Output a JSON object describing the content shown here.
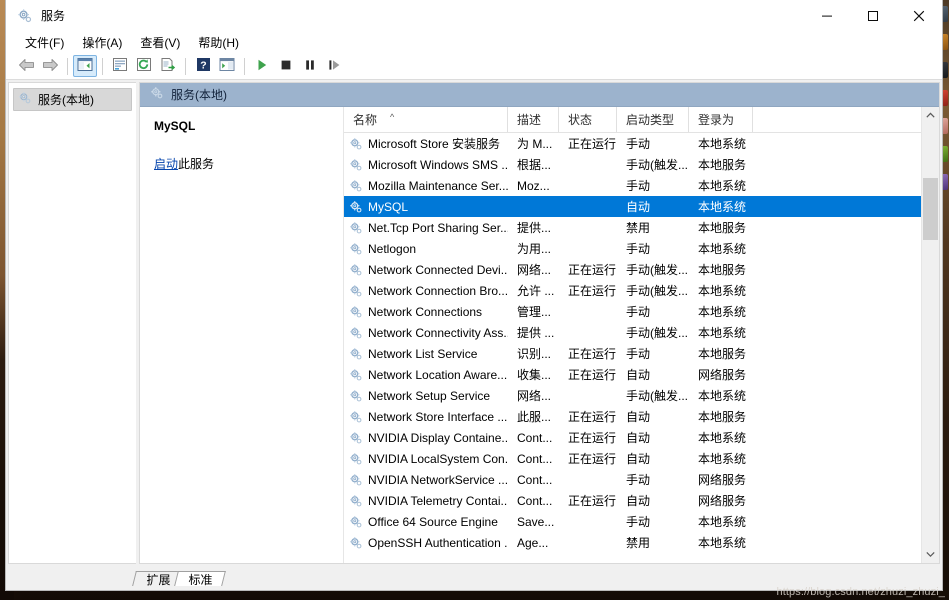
{
  "window": {
    "title": "服务",
    "app_icon": "services-gear-icon",
    "controls": {
      "minimize": "—",
      "maximize": "▭",
      "close": "✕"
    }
  },
  "menubar": {
    "items": [
      {
        "label": "文件(F)",
        "name": "menu-file"
      },
      {
        "label": "操作(A)",
        "name": "menu-action"
      },
      {
        "label": "查看(V)",
        "name": "menu-view"
      },
      {
        "label": "帮助(H)",
        "name": "menu-help"
      }
    ]
  },
  "toolbar": {
    "buttons": [
      {
        "icon": "back-arrow-icon",
        "name": "toolbar-back",
        "pressed": false
      },
      {
        "icon": "forward-arrow-icon",
        "name": "toolbar-forward",
        "pressed": false
      },
      {
        "icon": "show-hide-tree-icon",
        "name": "toolbar-show-hide-console-tree",
        "pressed": true
      },
      {
        "icon": "properties-icon",
        "name": "toolbar-properties",
        "pressed": false
      },
      {
        "icon": "refresh-icon",
        "name": "toolbar-refresh",
        "pressed": false
      },
      {
        "icon": "export-list-icon",
        "name": "toolbar-export-list",
        "pressed": false
      },
      {
        "icon": "help-icon",
        "name": "toolbar-help",
        "pressed": false
      },
      {
        "icon": "show-action-pane-icon",
        "name": "toolbar-show-action-pane",
        "pressed": false
      },
      {
        "icon": "start-service-icon",
        "name": "toolbar-start-service",
        "pressed": false
      },
      {
        "icon": "stop-service-icon",
        "name": "toolbar-stop-service",
        "pressed": false
      },
      {
        "icon": "pause-service-icon",
        "name": "toolbar-pause-service",
        "pressed": false
      },
      {
        "icon": "restart-service-icon",
        "name": "toolbar-restart-service",
        "pressed": false
      }
    ]
  },
  "tree": {
    "node_label": "服务(本地)",
    "node_icon": "services-gear-icon"
  },
  "pane": {
    "header_label": "服务(本地)",
    "header_icon": "services-gear-icon"
  },
  "details": {
    "service_title": "MySQL",
    "action_link": "启动",
    "action_suffix": "此服务"
  },
  "list": {
    "columns": [
      {
        "label": "名称",
        "key": "name",
        "width": 164,
        "sort": "asc",
        "sort_glyph": "^"
      },
      {
        "label": "描述",
        "key": "description",
        "width": 51
      },
      {
        "label": "状态",
        "key": "status",
        "width": 58
      },
      {
        "label": "启动类型",
        "key": "startup",
        "width": 72
      },
      {
        "label": "登录为",
        "key": "logon",
        "width": 64
      }
    ],
    "rows": [
      {
        "name": "Microsoft Store 安装服务",
        "description": "为 M...",
        "status": "正在运行",
        "startup": "手动",
        "logon": "本地系统",
        "selected": false
      },
      {
        "name": "Microsoft Windows SMS ...",
        "description": "根据...",
        "status": "",
        "startup": "手动(触发...",
        "logon": "本地服务",
        "selected": false
      },
      {
        "name": "Mozilla Maintenance Ser...",
        "description": "Moz...",
        "status": "",
        "startup": "手动",
        "logon": "本地系统",
        "selected": false
      },
      {
        "name": "MySQL",
        "description": "",
        "status": "",
        "startup": "自动",
        "logon": "本地系统",
        "selected": true
      },
      {
        "name": "Net.Tcp Port Sharing Ser...",
        "description": "提供...",
        "status": "",
        "startup": "禁用",
        "logon": "本地服务",
        "selected": false
      },
      {
        "name": "Netlogon",
        "description": "为用...",
        "status": "",
        "startup": "手动",
        "logon": "本地系统",
        "selected": false
      },
      {
        "name": "Network Connected Devi...",
        "description": "网络...",
        "status": "正在运行",
        "startup": "手动(触发...",
        "logon": "本地服务",
        "selected": false
      },
      {
        "name": "Network Connection Bro...",
        "description": "允许 ...",
        "status": "正在运行",
        "startup": "手动(触发...",
        "logon": "本地系统",
        "selected": false
      },
      {
        "name": "Network Connections",
        "description": "管理...",
        "status": "",
        "startup": "手动",
        "logon": "本地系统",
        "selected": false
      },
      {
        "name": "Network Connectivity Ass...",
        "description": "提供 ...",
        "status": "",
        "startup": "手动(触发...",
        "logon": "本地系统",
        "selected": false
      },
      {
        "name": "Network List Service",
        "description": "识别...",
        "status": "正在运行",
        "startup": "手动",
        "logon": "本地服务",
        "selected": false
      },
      {
        "name": "Network Location Aware...",
        "description": "收集...",
        "status": "正在运行",
        "startup": "自动",
        "logon": "网络服务",
        "selected": false
      },
      {
        "name": "Network Setup Service",
        "description": "网络...",
        "status": "",
        "startup": "手动(触发...",
        "logon": "本地系统",
        "selected": false
      },
      {
        "name": "Network Store Interface ...",
        "description": "此服...",
        "status": "正在运行",
        "startup": "自动",
        "logon": "本地服务",
        "selected": false
      },
      {
        "name": "NVIDIA Display Containe...",
        "description": "Cont...",
        "status": "正在运行",
        "startup": "自动",
        "logon": "本地系统",
        "selected": false
      },
      {
        "name": "NVIDIA LocalSystem Con...",
        "description": "Cont...",
        "status": "正在运行",
        "startup": "自动",
        "logon": "本地系统",
        "selected": false
      },
      {
        "name": "NVIDIA NetworkService ...",
        "description": "Cont...",
        "status": "",
        "startup": "手动",
        "logon": "网络服务",
        "selected": false
      },
      {
        "name": "NVIDIA Telemetry Contai...",
        "description": "Cont...",
        "status": "正在运行",
        "startup": "自动",
        "logon": "网络服务",
        "selected": false
      },
      {
        "name": "Office 64 Source Engine",
        "description": "Save...",
        "status": "",
        "startup": "手动",
        "logon": "本地系统",
        "selected": false
      },
      {
        "name": "OpenSSH Authentication ...",
        "description": "Age...",
        "status": "",
        "startup": "禁用",
        "logon": "本地系统",
        "selected": false
      }
    ]
  },
  "tabs": [
    {
      "label": "扩展",
      "active": false,
      "name": "tab-extended"
    },
    {
      "label": "标准",
      "active": true,
      "name": "tab-standard"
    }
  ],
  "scrollbar": {
    "up_glyph": "⌃",
    "down_glyph": "⌄"
  },
  "watermark": "https://blog.csdn.net/zhuzi_zhuzi_",
  "colors": {
    "selection": "#0078d7",
    "pane_header": "#9cb3cd",
    "link": "#0645ad",
    "window_bg": "#f0f0f0"
  }
}
